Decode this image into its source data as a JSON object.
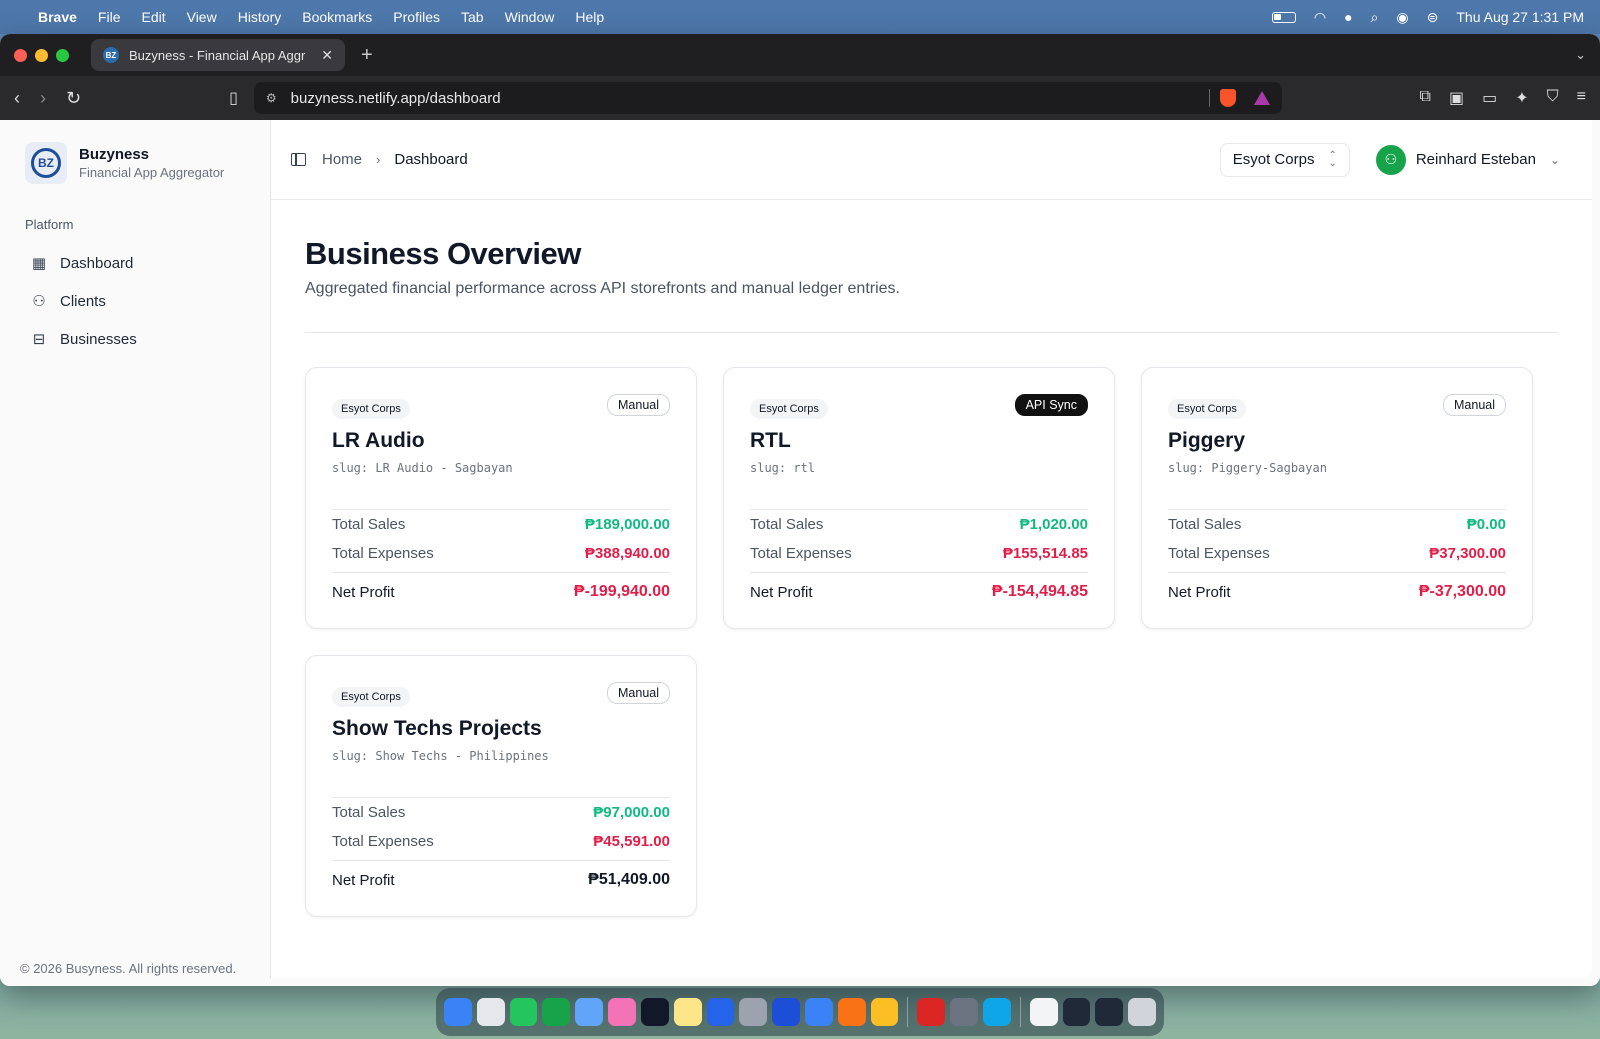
{
  "menubar": {
    "app": "Brave",
    "items": [
      "File",
      "Edit",
      "View",
      "History",
      "Bookmarks",
      "Profiles",
      "Tab",
      "Window",
      "Help"
    ],
    "clock": "Thu Aug 27  1:31 PM"
  },
  "browser": {
    "tab_title": "Buzyness - Financial App Aggr",
    "url": "buzyness.netlify.app/dashboard"
  },
  "brand": {
    "name": "Buzyness",
    "subtitle": "Financial App Aggregator",
    "logo_text": "BZ"
  },
  "sidebar": {
    "section": "Platform",
    "items": [
      {
        "label": "Dashboard",
        "icon": "dashboard-grid-icon"
      },
      {
        "label": "Clients",
        "icon": "user-icon"
      },
      {
        "label": "Businesses",
        "icon": "briefcase-icon"
      }
    ],
    "footer": "© 2026 Busyness. All rights reserved."
  },
  "header": {
    "breadcrumb": [
      "Home",
      "Dashboard"
    ],
    "org_select": "Esyot Corps",
    "user_name": "Reinhard Esteban"
  },
  "page": {
    "title": "Business Overview",
    "subtitle": "Aggregated financial performance across API storefronts and manual ledger entries."
  },
  "labels": {
    "total_sales": "Total Sales",
    "total_expenses": "Total Expenses",
    "net_profit": "Net Profit"
  },
  "cards": [
    {
      "org": "Esyot Corps",
      "type": "Manual",
      "name": "LR Audio",
      "slug": "slug: LR Audio - Sagbayan",
      "sales": "₱189,000.00",
      "expenses": "₱388,940.00",
      "net": "₱-199,940.00",
      "net_status": "negative"
    },
    {
      "org": "Esyot Corps",
      "type": "API Sync",
      "name": "RTL",
      "slug": "slug: rtl",
      "sales": "₱1,020.00",
      "expenses": "₱155,514.85",
      "net": "₱-154,494.85",
      "net_status": "negative"
    },
    {
      "org": "Esyot Corps",
      "type": "Manual",
      "name": "Piggery",
      "slug": "slug: Piggery-Sagbayan",
      "sales": "₱0.00",
      "expenses": "₱37,300.00",
      "net": "₱-37,300.00",
      "net_status": "negative"
    },
    {
      "org": "Esyot Corps",
      "type": "Manual",
      "name": "Show Techs Projects",
      "slug": "slug: Show Techs - Philippines",
      "sales": "₱97,000.00",
      "expenses": "₱45,591.00",
      "net": "₱51,409.00",
      "net_status": "positive"
    }
  ],
  "colors": {
    "sales_green": "#10b981",
    "expense_pink": "#e11d48",
    "api_badge_bg": "#111111",
    "avatar_green": "#16a34a"
  }
}
